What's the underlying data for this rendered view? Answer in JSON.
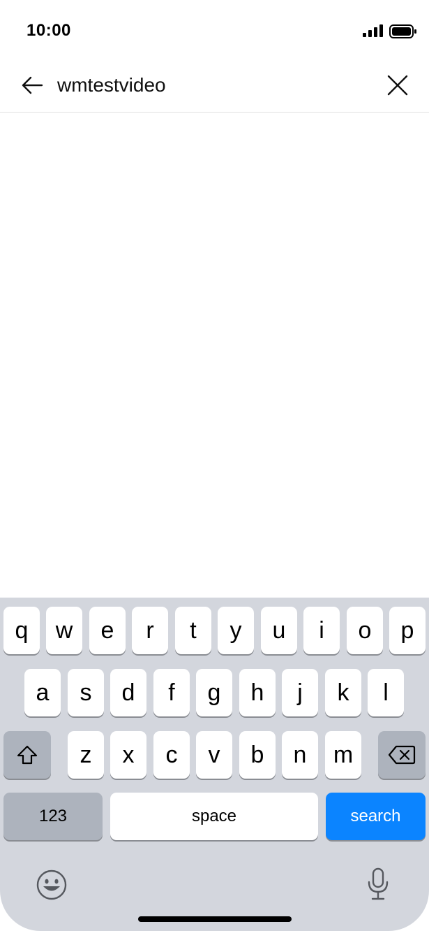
{
  "status_bar": {
    "time": "10:00"
  },
  "search": {
    "query": "wmtestvideo"
  },
  "keyboard": {
    "row1": [
      "q",
      "w",
      "e",
      "r",
      "t",
      "y",
      "u",
      "i",
      "o",
      "p"
    ],
    "row2": [
      "a",
      "s",
      "d",
      "f",
      "g",
      "h",
      "j",
      "k",
      "l"
    ],
    "row3": [
      "z",
      "x",
      "c",
      "v",
      "b",
      "n",
      "m"
    ],
    "numbers_label": "123",
    "space_label": "space",
    "search_label": "search"
  },
  "colors": {
    "search_key": "#0b84ff",
    "keyboard_bg": "#d3d6dd"
  }
}
